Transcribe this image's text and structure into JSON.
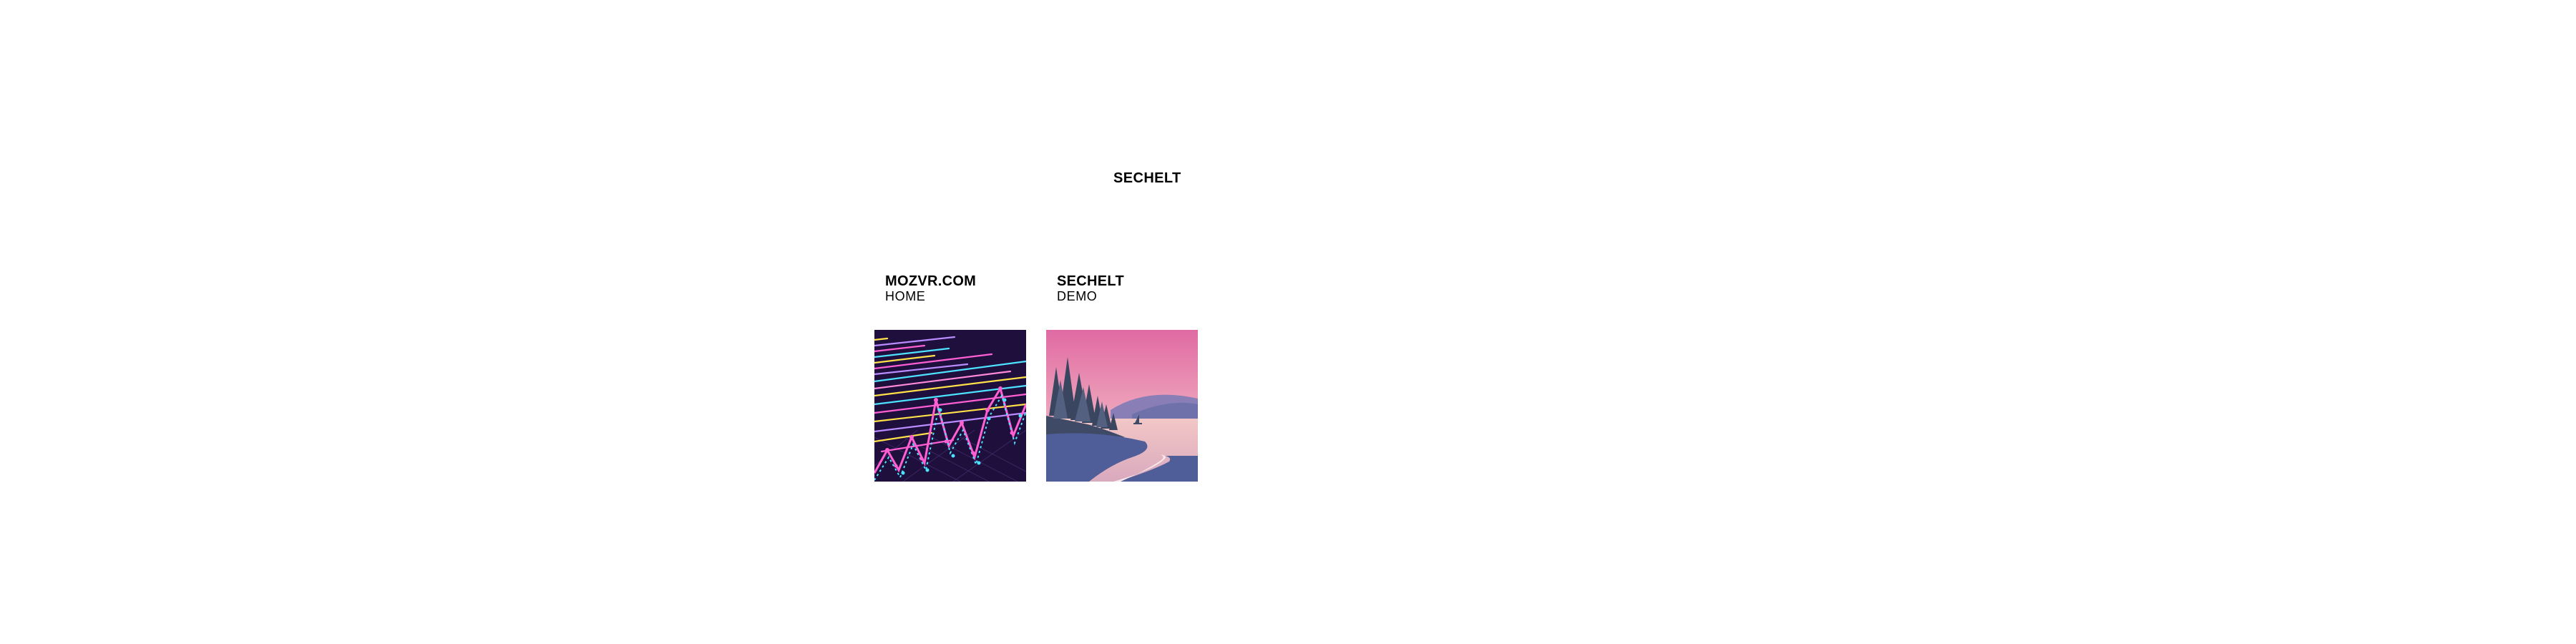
{
  "header": {
    "title": "SECHELT"
  },
  "cards": [
    {
      "title": "MOZVR.COM",
      "subtitle": "HOME",
      "thumbnail_icon": "neon-waveform-grid-thumbnail"
    },
    {
      "title": "SECHELT",
      "subtitle": "DEMO",
      "thumbnail_icon": "sunset-lake-landscape-thumbnail"
    }
  ],
  "colors": {
    "background": "#ffffff",
    "text": "#000000",
    "neon_bg": "#1f0f3d",
    "neon_pink": "#ff5fd2",
    "neon_cyan": "#4de3ff",
    "neon_yellow": "#ffe14a",
    "sunset_sky_top": "#e06aa3",
    "sunset_sky_bottom": "#f3c6c7",
    "lake": "#dcb6c4",
    "land": "#4f5e98",
    "trees": "#3f4a66"
  }
}
